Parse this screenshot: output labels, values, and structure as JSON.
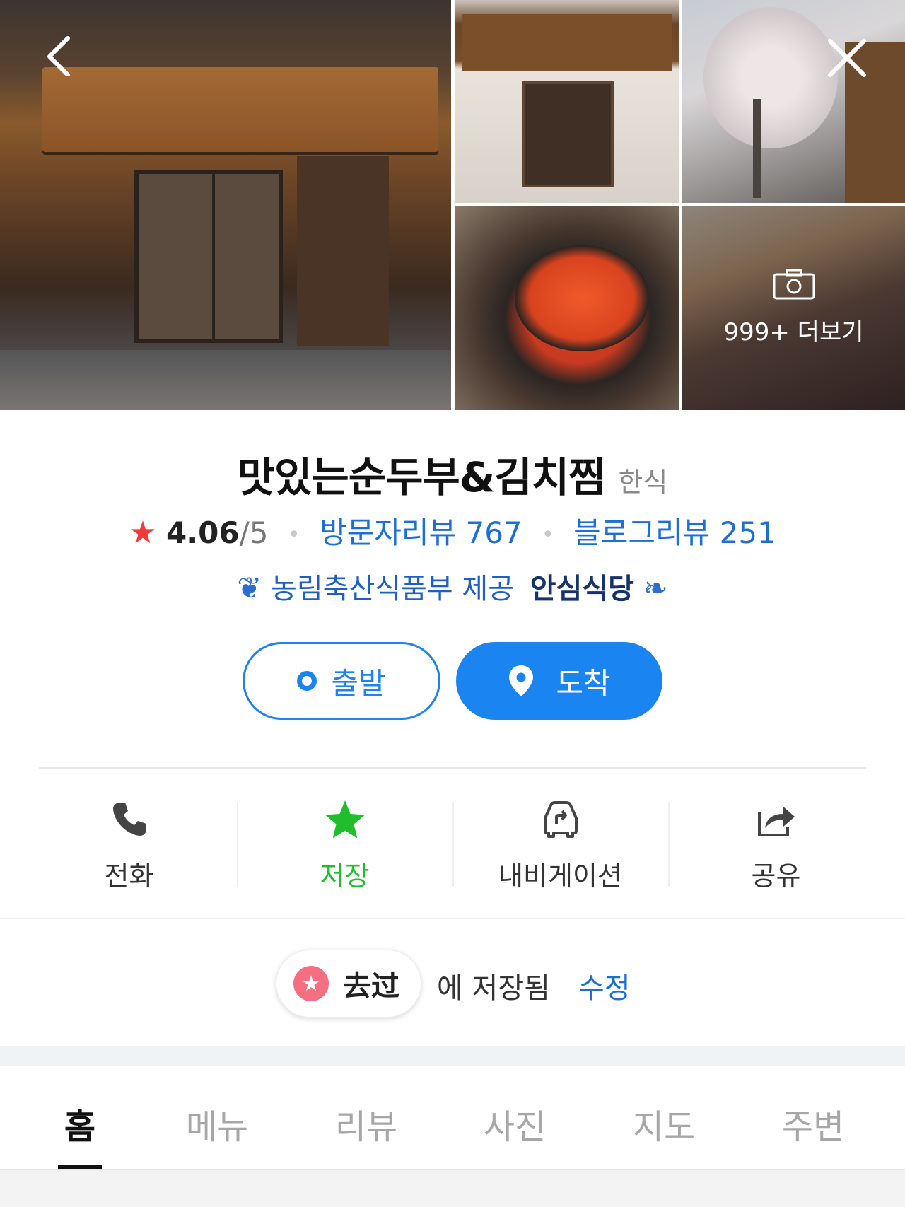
{
  "gallery": {
    "more_label": "999+ 더보기",
    "photos": [
      "storefront-night",
      "storefront-day",
      "street-cherry-blossom",
      "sundubu-stew",
      "rice-spoon"
    ]
  },
  "header": {
    "back_icon": "chevron-left-icon",
    "close_icon": "close-icon"
  },
  "place": {
    "name": "맛있는순두부&김치찜",
    "category": "한식",
    "rating": "4.06",
    "rating_max": "/5",
    "visitor_reviews": "방문자리뷰 767",
    "blog_reviews": "블로그리뷰 251",
    "certification_prefix": "농림축산식품부 제공",
    "certification_name": "안심식당"
  },
  "route": {
    "depart_label": "출발",
    "arrive_label": "도착"
  },
  "actions": [
    {
      "label": "전화",
      "icon": "phone-icon"
    },
    {
      "label": "저장",
      "icon": "star-icon"
    },
    {
      "label": "내비게이션",
      "icon": "car-navigation-icon"
    },
    {
      "label": "공유",
      "icon": "share-icon"
    }
  ],
  "saved": {
    "list_name": "去过",
    "saved_text": "에 저장됨",
    "edit_label": "수정"
  },
  "tabs": [
    {
      "label": "홈",
      "active": true
    },
    {
      "label": "메뉴",
      "active": false
    },
    {
      "label": "리뷰",
      "active": false
    },
    {
      "label": "사진",
      "active": false
    },
    {
      "label": "지도",
      "active": false
    },
    {
      "label": "주변",
      "active": false
    }
  ],
  "colors": {
    "accent_blue": "#1a84f0",
    "link_blue": "#1c6fd6",
    "save_green": "#1fbf2b",
    "rating_red": "#f23a3a",
    "list_pink": "#f46f82"
  }
}
